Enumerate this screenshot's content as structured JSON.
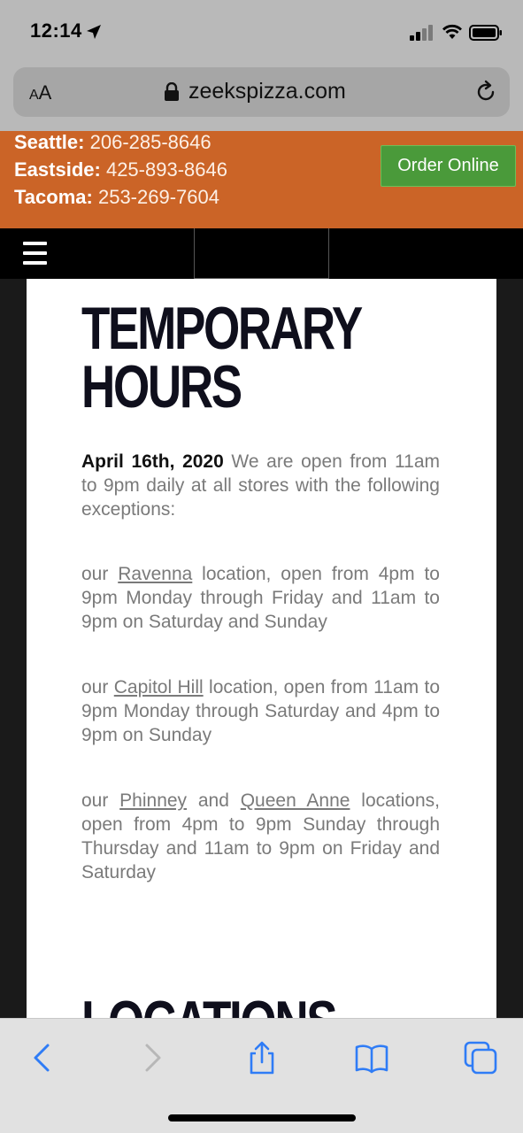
{
  "status_bar": {
    "time": "12:14"
  },
  "browser": {
    "aa_label": "AA",
    "url": "zeekspizza.com"
  },
  "contact": {
    "lines": [
      {
        "city": "Seattle:",
        "phone": "206-285-8646"
      },
      {
        "city": "Eastside:",
        "phone": "425-893-8646"
      },
      {
        "city": "Tacoma:",
        "phone": "253-269-7604"
      }
    ],
    "order_button": "Order Online"
  },
  "content": {
    "heading_line1": "TEMPORARY",
    "heading_line2": "HOURS",
    "intro_date": "April 16th, 2020",
    "intro_text": " We are open from 11am to 9pm daily at all stores with the following exceptions:",
    "p1_prefix": "our ",
    "p1_link": "Ravenna",
    "p1_suffix": " location, open from 4pm to 9pm Monday through Friday and 11am to 9pm on Saturday and Sunday",
    "p2_prefix": "our ",
    "p2_link": "Capitol Hill",
    "p2_suffix": " location, open from 11am to 9pm Monday through Saturday and 4pm to 9pm on Sunday",
    "p3_prefix": "our ",
    "p3_link1": "Phinney",
    "p3_mid": " and ",
    "p3_link2": "Queen Anne",
    "p3_suffix": " locations, open from 4pm to 9pm Sunday through Thursday and 11am to 9pm on Friday and Saturday",
    "next_heading": "LOCATIONS"
  },
  "toolbar": {
    "icons": [
      "back-icon",
      "forward-icon",
      "share-icon",
      "bookmarks-icon",
      "tabs-icon"
    ]
  },
  "colors": {
    "orange": "#cb6427",
    "green": "#4a9a3a",
    "ios_blue": "#2f7cf6"
  }
}
